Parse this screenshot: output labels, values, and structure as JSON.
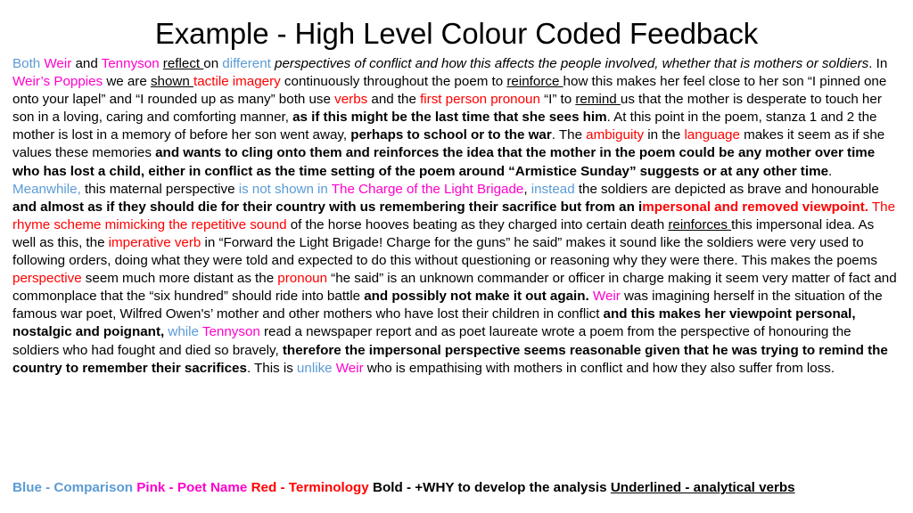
{
  "slide": {
    "title": "Example - High Level Colour Coded Feedback",
    "background_color": "#FFFFFF"
  },
  "colors": {
    "comparison_blue": "#5B9BD5",
    "poet_name_pink": "#FF00CC",
    "terminology_red": "#FF0000",
    "default_text": "#000000"
  },
  "body": {
    "runs": [
      {
        "text": "Both ",
        "color": "blue",
        "bold": false,
        "italic": false,
        "underline": false
      },
      {
        "text": "Weir",
        "color": "pink",
        "bold": false,
        "italic": false,
        "underline": false
      },
      {
        "text": " and ",
        "color": "black",
        "bold": false,
        "italic": false,
        "underline": false
      },
      {
        "text": "Tennyson",
        "color": "pink",
        "bold": false,
        "italic": false,
        "underline": false
      },
      {
        "text": " ",
        "color": "black",
        "bold": false,
        "italic": false,
        "underline": false
      },
      {
        "text": "reflect ",
        "color": "black",
        "bold": false,
        "italic": false,
        "underline": true
      },
      {
        "text": "on ",
        "color": "black",
        "bold": false,
        "italic": false,
        "underline": false
      },
      {
        "text": "different",
        "color": "blue",
        "bold": false,
        "italic": false,
        "underline": false
      },
      {
        "text": " ",
        "color": "black",
        "bold": false,
        "italic": false,
        "underline": false
      },
      {
        "text": "perspectives of conflict and how this affects the people involved, whether that is mothers or soldiers",
        "color": "black",
        "bold": false,
        "italic": true,
        "underline": false
      },
      {
        "text": ". In ",
        "color": "black",
        "bold": false,
        "italic": false,
        "underline": false
      },
      {
        "text": "Weir’s Poppies",
        "color": "pink",
        "bold": false,
        "italic": false,
        "underline": false
      },
      {
        "text": " we are ",
        "color": "black",
        "bold": false,
        "italic": false,
        "underline": false
      },
      {
        "text": "shown ",
        "color": "black",
        "bold": false,
        "italic": false,
        "underline": true
      },
      {
        "text": "tactile imagery",
        "color": "red",
        "bold": false,
        "italic": false,
        "underline": false
      },
      {
        "text": " continuously throughout the poem to ",
        "color": "black",
        "bold": false,
        "italic": false,
        "underline": false
      },
      {
        "text": "reinforce ",
        "color": "black",
        "bold": false,
        "italic": false,
        "underline": true
      },
      {
        "text": "how this makes her feel close to her son “I pinned one onto your lapel” and “I rounded up as many” both use ",
        "color": "black",
        "bold": false,
        "italic": false,
        "underline": false
      },
      {
        "text": "verbs",
        "color": "red",
        "bold": false,
        "italic": false,
        "underline": false
      },
      {
        "text": " and the ",
        "color": "black",
        "bold": false,
        "italic": false,
        "underline": false
      },
      {
        "text": "first person pronoun",
        "color": "red",
        "bold": false,
        "italic": false,
        "underline": false
      },
      {
        "text": " “I” to ",
        "color": "black",
        "bold": false,
        "italic": false,
        "underline": false
      },
      {
        "text": "remind ",
        "color": "black",
        "bold": false,
        "italic": false,
        "underline": true
      },
      {
        "text": "us that the mother is desperate to touch her son in a loving, caring and comforting manner, ",
        "color": "black",
        "bold": false,
        "italic": false,
        "underline": false
      },
      {
        "text": "as if this might be the last time that she sees him",
        "color": "black",
        "bold": true,
        "italic": false,
        "underline": false
      },
      {
        "text": ". At this point in the poem, stanza 1 and 2 the mother is lost in a memory of before her son went away, ",
        "color": "black",
        "bold": false,
        "italic": false,
        "underline": false
      },
      {
        "text": "perhaps to school or to the war",
        "color": "black",
        "bold": true,
        "italic": false,
        "underline": false
      },
      {
        "text": ". The ",
        "color": "black",
        "bold": false,
        "italic": false,
        "underline": false
      },
      {
        "text": "ambiguity",
        "color": "red",
        "bold": false,
        "italic": false,
        "underline": false
      },
      {
        "text": " in the ",
        "color": "black",
        "bold": false,
        "italic": false,
        "underline": false
      },
      {
        "text": "language",
        "color": "red",
        "bold": false,
        "italic": false,
        "underline": false
      },
      {
        "text": " makes it seem as if she values these memories ",
        "color": "black",
        "bold": false,
        "italic": false,
        "underline": false
      },
      {
        "text": "and wants to cling onto them and reinforces the idea that the mother in the poem could be any mother over time who has lost a child, either in conflict as the time setting of the poem around “Armistice Sunday” suggests or at any other time",
        "color": "black",
        "bold": true,
        "italic": false,
        "underline": false
      },
      {
        "text": ". ",
        "color": "black",
        "bold": false,
        "italic": false,
        "underline": false
      },
      {
        "text": "Meanwhile,",
        "color": "blue",
        "bold": false,
        "italic": false,
        "underline": false
      },
      {
        "text": " this maternal perspective ",
        "color": "black",
        "bold": false,
        "italic": false,
        "underline": false
      },
      {
        "text": "is not shown in",
        "color": "blue",
        "bold": false,
        "italic": false,
        "underline": false
      },
      {
        "text": " ",
        "color": "black",
        "bold": false,
        "italic": false,
        "underline": false
      },
      {
        "text": "The Charge of the Light Brigade",
        "color": "pink",
        "bold": false,
        "italic": false,
        "underline": false
      },
      {
        "text": ", ",
        "color": "black",
        "bold": false,
        "italic": false,
        "underline": false
      },
      {
        "text": "instead",
        "color": "blue",
        "bold": false,
        "italic": false,
        "underline": false
      },
      {
        "text": " the soldiers are depicted as brave and honourable ",
        "color": "black",
        "bold": false,
        "italic": false,
        "underline": false
      },
      {
        "text": "and almost as if they should die for their country with us remembering their sacrifice but from an i",
        "color": "black",
        "bold": true,
        "italic": false,
        "underline": false
      },
      {
        "text": "mpersonal and removed viewpoint.",
        "color": "red",
        "bold": true,
        "italic": false,
        "underline": false
      },
      {
        "text": " ",
        "color": "black",
        "bold": false,
        "italic": false,
        "underline": false
      },
      {
        "text": "The rhyme scheme mimicking the repetitive sound",
        "color": "red",
        "bold": false,
        "italic": false,
        "underline": false
      },
      {
        "text": " of the horse hooves beating as they charged into certain death ",
        "color": "black",
        "bold": false,
        "italic": false,
        "underline": false
      },
      {
        "text": "reinforces ",
        "color": "black",
        "bold": false,
        "italic": false,
        "underline": true
      },
      {
        "text": "this impersonal idea. As well as this, the ",
        "color": "black",
        "bold": false,
        "italic": false,
        "underline": false
      },
      {
        "text": "imperative verb",
        "color": "red",
        "bold": false,
        "italic": false,
        "underline": false
      },
      {
        "text": " in “Forward the Light Brigade! Charge for the guns” he said” makes it sound like the soldiers were very used to following orders, doing what they were told and expected to do this without questioning or reasoning why they were there. This makes the poems ",
        "color": "black",
        "bold": false,
        "italic": false,
        "underline": false
      },
      {
        "text": "perspective",
        "color": "red",
        "bold": false,
        "italic": false,
        "underline": false
      },
      {
        "text": " seem much more distant as the ",
        "color": "black",
        "bold": false,
        "italic": false,
        "underline": false
      },
      {
        "text": "pronoun",
        "color": "red",
        "bold": false,
        "italic": false,
        "underline": false
      },
      {
        "text": " “he said” is an unknown commander or officer in charge making it seem very matter of fact and commonplace that the “six hundred” should ride into battle ",
        "color": "black",
        "bold": false,
        "italic": false,
        "underline": false
      },
      {
        "text": "and possibly not make it out again.",
        "color": "black",
        "bold": true,
        "italic": false,
        "underline": false
      },
      {
        "text": " ",
        "color": "black",
        "bold": false,
        "italic": false,
        "underline": false
      },
      {
        "text": "Weir",
        "color": "pink",
        "bold": false,
        "italic": false,
        "underline": false
      },
      {
        "text": " was imagining herself in the situation of the famous war poet, Wilfred Owen's’ mother and other mothers who have lost their children in conflict ",
        "color": "black",
        "bold": false,
        "italic": false,
        "underline": false
      },
      {
        "text": "and this makes her viewpoint personal, nostalgic and poignant,",
        "color": "black",
        "bold": true,
        "italic": false,
        "underline": false
      },
      {
        "text": " ",
        "color": "black",
        "bold": false,
        "italic": false,
        "underline": false
      },
      {
        "text": "while",
        "color": "blue",
        "bold": false,
        "italic": false,
        "underline": false
      },
      {
        "text": " ",
        "color": "black",
        "bold": false,
        "italic": false,
        "underline": false
      },
      {
        "text": "Tennyson",
        "color": "pink",
        "bold": false,
        "italic": false,
        "underline": false
      },
      {
        "text": " read a newspaper report and as poet laureate wrote a poem from the perspective of honouring the soldiers who had fought and died so bravely, ",
        "color": "black",
        "bold": false,
        "italic": false,
        "underline": false
      },
      {
        "text": "therefore the impersonal perspective seems reasonable given that he was trying to remind the country to remember their sacrifices",
        "color": "black",
        "bold": true,
        "italic": false,
        "underline": false
      },
      {
        "text": ". This is ",
        "color": "black",
        "bold": false,
        "italic": false,
        "underline": false
      },
      {
        "text": "unlike",
        "color": "blue",
        "bold": false,
        "italic": false,
        "underline": false
      },
      {
        "text": " ",
        "color": "black",
        "bold": false,
        "italic": false,
        "underline": false
      },
      {
        "text": "Weir",
        "color": "pink",
        "bold": false,
        "italic": false,
        "underline": false
      },
      {
        "text": " who is empathising with mothers in conflict and how they also suffer from loss.",
        "color": "black",
        "bold": false,
        "italic": false,
        "underline": false
      }
    ]
  },
  "legend": {
    "items": [
      {
        "text": "Blue - Comparison",
        "color": "blue",
        "bold": true,
        "underline": false
      },
      {
        "text": " ",
        "color": "black",
        "bold": true,
        "underline": false
      },
      {
        "text": "Pink - Poet Name",
        "color": "pink",
        "bold": true,
        "underline": false
      },
      {
        "text": " ",
        "color": "black",
        "bold": true,
        "underline": false
      },
      {
        "text": "Red - Terminology",
        "color": "red",
        "bold": true,
        "underline": false
      },
      {
        "text": " ",
        "color": "black",
        "bold": true,
        "underline": false
      },
      {
        "text": "Bold - +WHY to develop the analysis",
        "color": "black",
        "bold": true,
        "underline": false
      },
      {
        "text": " ",
        "color": "black",
        "bold": true,
        "underline": false
      },
      {
        "text": "Underlined - analytical verbs",
        "color": "black",
        "bold": true,
        "underline": true
      }
    ]
  }
}
